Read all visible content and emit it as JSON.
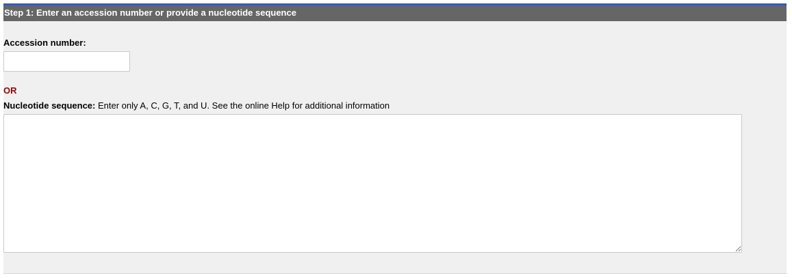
{
  "step": {
    "header": "Step 1: Enter an accession number or provide a nucleotide sequence"
  },
  "accession": {
    "label": "Accession number:",
    "value": "",
    "placeholder": ""
  },
  "separator": {
    "or_label": "OR"
  },
  "nucleotide": {
    "label": "Nucleotide sequence:",
    "hint": "Enter only A, C, G, T, and U. See the online Help for additional information",
    "value": "",
    "placeholder": ""
  },
  "colors": {
    "header_bg": "#666666",
    "header_accent": "#3458c8",
    "panel_bg": "#f0f0f0",
    "or_color": "#990000"
  }
}
